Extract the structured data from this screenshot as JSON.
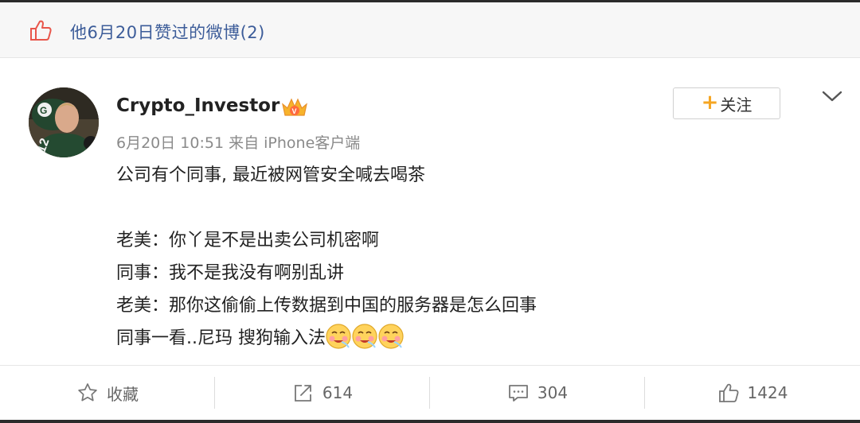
{
  "liked_bar": {
    "text": "他6月20日赞过的微博(2)"
  },
  "post": {
    "username": "Crypto_Investor",
    "meta": "6月20日 10:51 来自 iPhone客户端",
    "follow_label": "关注",
    "lines": [
      "公司有个同事, 最近被网管安全喊去喝茶",
      "",
      "老美：你丫是不是出卖公司机密啊",
      "同事：我不是我没有啊别乱讲",
      "老美：那你这偷偷上传数据到中国的服务器是怎么回事",
      "同事一看..尼玛 搜狗输入法"
    ],
    "emoji_count": 3
  },
  "actions": {
    "favorite_label": "收藏",
    "repost_count": "614",
    "comment_count": "304",
    "like_count": "1424"
  },
  "colors": {
    "link_blue": "#3c5c99",
    "like_icon": "#e8564b",
    "follow_plus": "#f5a623"
  }
}
